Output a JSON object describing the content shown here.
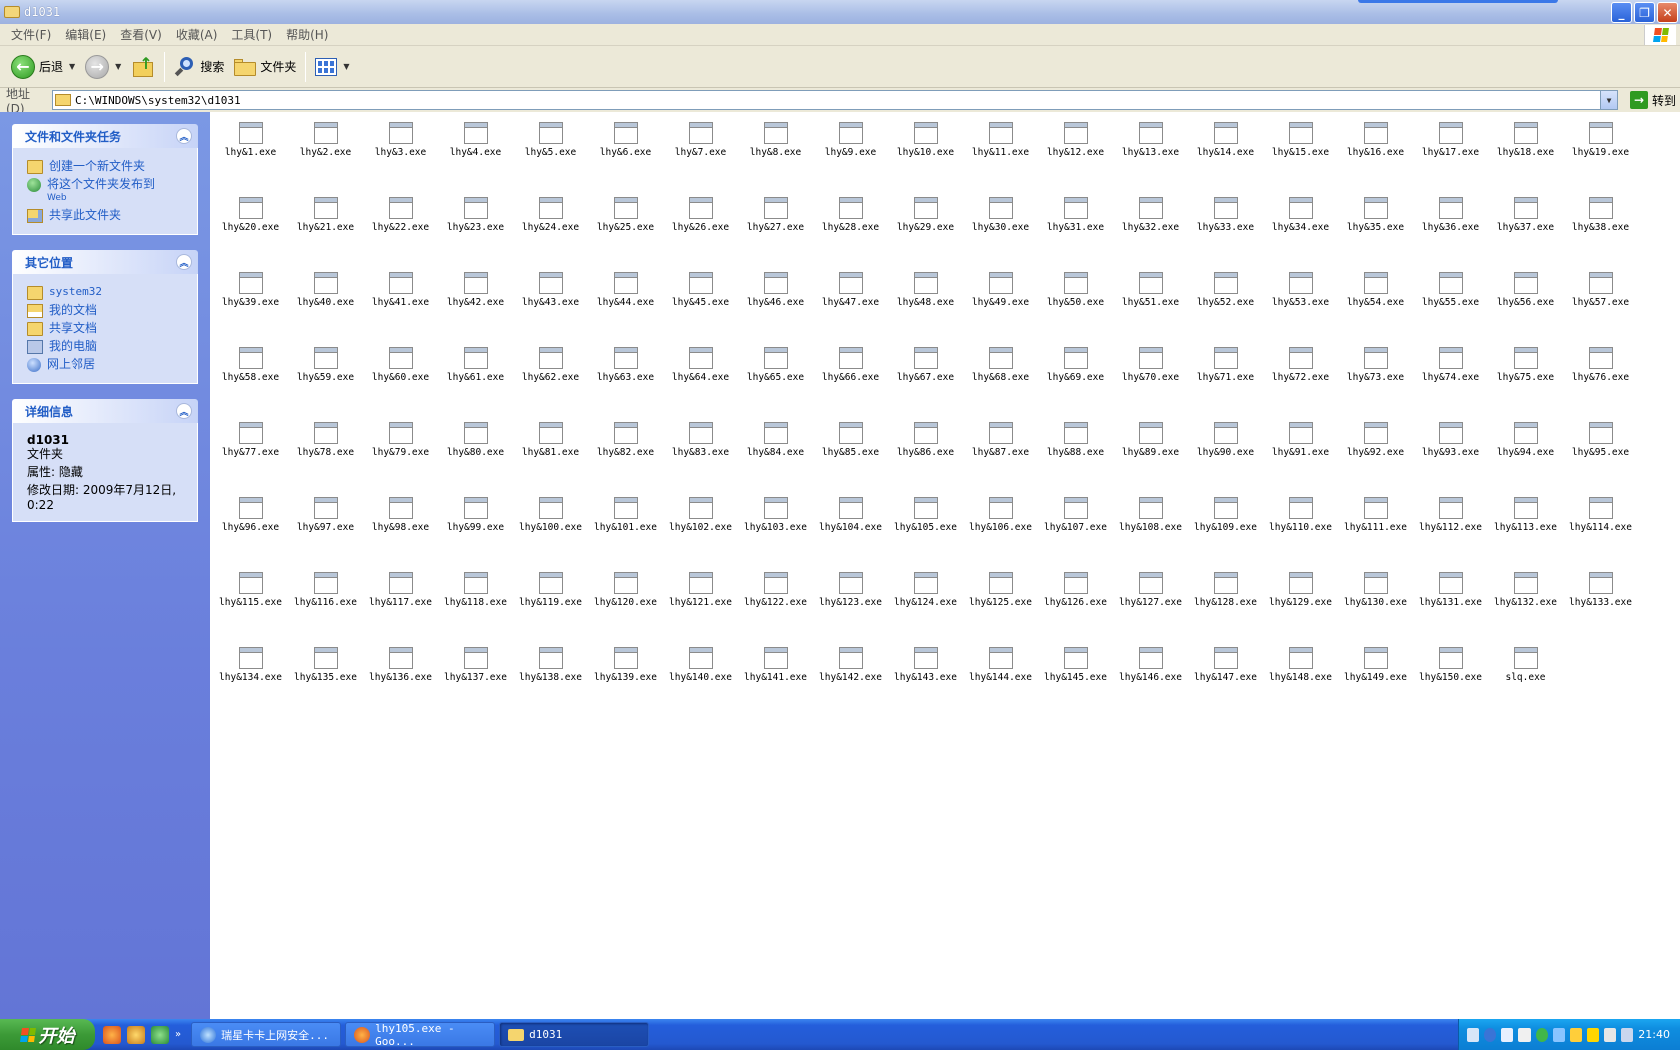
{
  "window": {
    "title": "d1031"
  },
  "menu": [
    "文件(F)",
    "编辑(E)",
    "查看(V)",
    "收藏(A)",
    "工具(T)",
    "帮助(H)"
  ],
  "toolbar": {
    "back_label": "后退",
    "search_label": "搜索",
    "folders_label": "文件夹"
  },
  "address": {
    "label": "地址(D)",
    "value": "C:\\WINDOWS\\system32\\d1031",
    "go_label": "转到"
  },
  "sidebar": {
    "tasks": {
      "title": "文件和文件夹任务",
      "items": [
        {
          "label": "创建一个新文件夹",
          "icon": "new-folder-icon"
        },
        {
          "label": "将这个文件夹发布到",
          "sub": "Web",
          "icon": "publish-web-icon"
        },
        {
          "label": "共享此文件夹",
          "icon": "share-folder-icon"
        }
      ]
    },
    "places": {
      "title": "其它位置",
      "items": [
        {
          "label": "system32",
          "icon": "folder-icon"
        },
        {
          "label": "我的文档",
          "icon": "my-documents-icon"
        },
        {
          "label": "共享文档",
          "icon": "shared-documents-icon"
        },
        {
          "label": "我的电脑",
          "icon": "my-computer-icon"
        },
        {
          "label": "网上邻居",
          "icon": "network-places-icon"
        }
      ]
    },
    "details": {
      "title": "详细信息",
      "name": "d1031",
      "type": "文件夹",
      "attr": "属性: 隐藏",
      "modified": "修改日期: 2009年7月12日, 0:22"
    }
  },
  "files": [
    "lhy&1.exe",
    "lhy&2.exe",
    "lhy&3.exe",
    "lhy&4.exe",
    "lhy&5.exe",
    "lhy&6.exe",
    "lhy&7.exe",
    "lhy&8.exe",
    "lhy&9.exe",
    "lhy&10.exe",
    "lhy&11.exe",
    "lhy&12.exe",
    "lhy&13.exe",
    "lhy&14.exe",
    "lhy&15.exe",
    "lhy&16.exe",
    "lhy&17.exe",
    "lhy&18.exe",
    "lhy&19.exe",
    "lhy&20.exe",
    "lhy&21.exe",
    "lhy&22.exe",
    "lhy&23.exe",
    "lhy&24.exe",
    "lhy&25.exe",
    "lhy&26.exe",
    "lhy&27.exe",
    "lhy&28.exe",
    "lhy&29.exe",
    "lhy&30.exe",
    "lhy&31.exe",
    "lhy&32.exe",
    "lhy&33.exe",
    "lhy&34.exe",
    "lhy&35.exe",
    "lhy&36.exe",
    "lhy&37.exe",
    "lhy&38.exe",
    "lhy&39.exe",
    "lhy&40.exe",
    "lhy&41.exe",
    "lhy&42.exe",
    "lhy&43.exe",
    "lhy&44.exe",
    "lhy&45.exe",
    "lhy&46.exe",
    "lhy&47.exe",
    "lhy&48.exe",
    "lhy&49.exe",
    "lhy&50.exe",
    "lhy&51.exe",
    "lhy&52.exe",
    "lhy&53.exe",
    "lhy&54.exe",
    "lhy&55.exe",
    "lhy&56.exe",
    "lhy&57.exe",
    "lhy&58.exe",
    "lhy&59.exe",
    "lhy&60.exe",
    "lhy&61.exe",
    "lhy&62.exe",
    "lhy&63.exe",
    "lhy&64.exe",
    "lhy&65.exe",
    "lhy&66.exe",
    "lhy&67.exe",
    "lhy&68.exe",
    "lhy&69.exe",
    "lhy&70.exe",
    "lhy&71.exe",
    "lhy&72.exe",
    "lhy&73.exe",
    "lhy&74.exe",
    "lhy&75.exe",
    "lhy&76.exe",
    "lhy&77.exe",
    "lhy&78.exe",
    "lhy&79.exe",
    "lhy&80.exe",
    "lhy&81.exe",
    "lhy&82.exe",
    "lhy&83.exe",
    "lhy&84.exe",
    "lhy&85.exe",
    "lhy&86.exe",
    "lhy&87.exe",
    "lhy&88.exe",
    "lhy&89.exe",
    "lhy&90.exe",
    "lhy&91.exe",
    "lhy&92.exe",
    "lhy&93.exe",
    "lhy&94.exe",
    "lhy&95.exe",
    "lhy&96.exe",
    "lhy&97.exe",
    "lhy&98.exe",
    "lhy&99.exe",
    "lhy&100.exe",
    "lhy&101.exe",
    "lhy&102.exe",
    "lhy&103.exe",
    "lhy&104.exe",
    "lhy&105.exe",
    "lhy&106.exe",
    "lhy&107.exe",
    "lhy&108.exe",
    "lhy&109.exe",
    "lhy&110.exe",
    "lhy&111.exe",
    "lhy&112.exe",
    "lhy&113.exe",
    "lhy&114.exe",
    "lhy&115.exe",
    "lhy&116.exe",
    "lhy&117.exe",
    "lhy&118.exe",
    "lhy&119.exe",
    "lhy&120.exe",
    "lhy&121.exe",
    "lhy&122.exe",
    "lhy&123.exe",
    "lhy&124.exe",
    "lhy&125.exe",
    "lhy&126.exe",
    "lhy&127.exe",
    "lhy&128.exe",
    "lhy&129.exe",
    "lhy&130.exe",
    "lhy&131.exe",
    "lhy&132.exe",
    "lhy&133.exe",
    "lhy&134.exe",
    "lhy&135.exe",
    "lhy&136.exe",
    "lhy&137.exe",
    "lhy&138.exe",
    "lhy&139.exe",
    "lhy&140.exe",
    "lhy&141.exe",
    "lhy&142.exe",
    "lhy&143.exe",
    "lhy&144.exe",
    "lhy&145.exe",
    "lhy&146.exe",
    "lhy&147.exe",
    "lhy&148.exe",
    "lhy&149.exe",
    "lhy&150.exe",
    "slq.exe"
  ],
  "taskbar": {
    "start_label": "开始",
    "tasks": [
      {
        "label": "瑞星卡卡上网安全...",
        "icon": "rising-icon",
        "active": false
      },
      {
        "label": "lhy105.exe - Goo...",
        "icon": "firefox-icon",
        "active": false
      },
      {
        "label": "d1031",
        "icon": "folder-icon",
        "active": true
      }
    ],
    "clock": "21:40"
  },
  "colors": {
    "sidebar": "#6a7fdc",
    "link": "#215dc6",
    "taskbar": "#245edb",
    "start": "#3c9a37"
  }
}
